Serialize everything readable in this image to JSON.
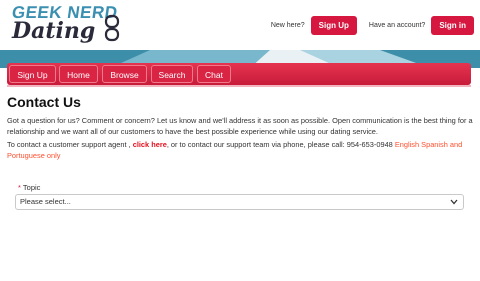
{
  "brand": {
    "logo_top": "GEEK NERD",
    "logo_bottom": "Dating"
  },
  "header": {
    "new_here": "New here?",
    "signup_label": "Sign Up",
    "have_account": "Have an account?",
    "signin_label": "Sign in"
  },
  "nav": {
    "items": [
      "Sign Up",
      "Home",
      "Browse",
      "Search",
      "Chat"
    ]
  },
  "page": {
    "title": "Contact Us",
    "intro": "Got a question for us? Comment or concern? Let us know and we'll address it as soon as possible. Open communication is the best thing for a relationship and we want all of our customers to have the best possible experience while using our dating service.",
    "support_prefix": "To contact a customer support agent ,",
    "click_here": "click here",
    "support_middle": ", or to contact our support team via phone, please call: 954-653-0948",
    "languages": "English Spanish and Portuguese only"
  },
  "form": {
    "required_mark": "*",
    "topic_label": "Topic",
    "topic_value": "Please select..."
  },
  "colors": {
    "accent": "#d6173f",
    "nav": "#d92444",
    "brand_blue": "#3b8fb0"
  },
  "icons": {
    "glasses": "glasses-icon",
    "dropdown": "chevron-down-icon"
  }
}
